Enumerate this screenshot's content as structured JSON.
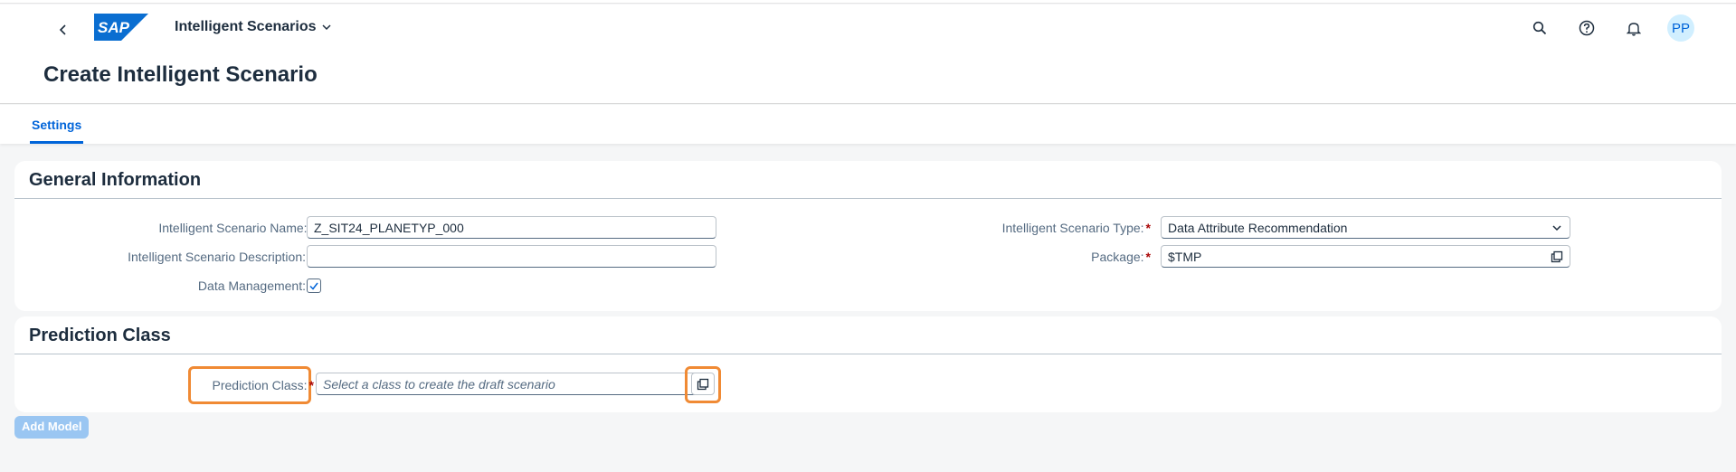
{
  "shell": {
    "app_title": "Intelligent Scenarios",
    "logo_text": "SAP",
    "avatar_initials": "PP",
    "icons": [
      "back-icon",
      "chevron-down-icon",
      "search-icon",
      "help-icon",
      "bell-icon"
    ]
  },
  "page": {
    "title": "Create Intelligent Scenario"
  },
  "tabs": [
    {
      "label": "Settings",
      "selected": true
    }
  ],
  "general_information": {
    "title": "General Information",
    "fields": {
      "name": {
        "label": "Intelligent Scenario Name:",
        "required": true,
        "value": "Z_SIT24_PLANETYP_000"
      },
      "description": {
        "label": "Intelligent Scenario Description:",
        "required": false,
        "value": ""
      },
      "data_management": {
        "label": "Data Management:",
        "checked": true
      },
      "type": {
        "label": "Intelligent Scenario Type:",
        "required": true,
        "value": "Data Attribute Recommendation"
      },
      "package": {
        "label": "Package:",
        "required": true,
        "value": "$TMP"
      }
    }
  },
  "prediction_class": {
    "title": "Prediction Class",
    "field": {
      "label": "Prediction Class:",
      "required": true,
      "value": "",
      "placeholder": "Select a class to create the draft scenario"
    }
  },
  "actions": {
    "add_model_label": "Add Model",
    "add_model_enabled": false
  },
  "colors": {
    "accent": "#0064d9",
    "required": "#aa0808",
    "highlight": "#f08a34",
    "disabled_button": "#9ac6f2"
  }
}
